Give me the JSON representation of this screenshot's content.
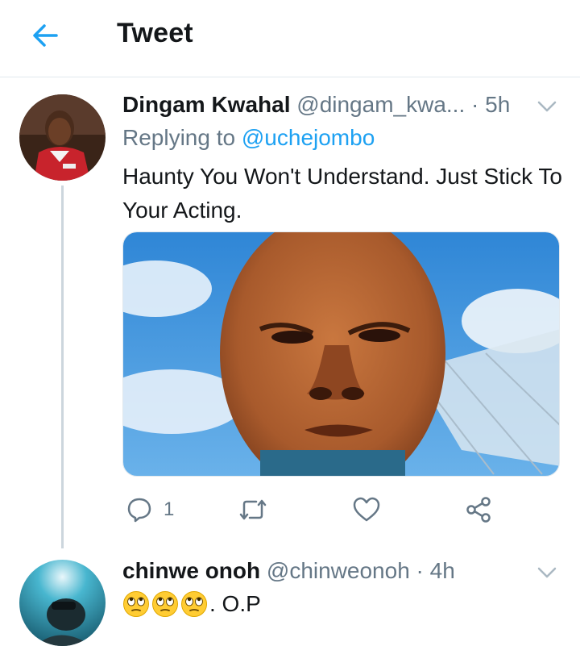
{
  "header": {
    "title": "Tweet"
  },
  "tweet1": {
    "name": "Dingam Kwahal",
    "handle": "@dingam_kwa...",
    "separator": " · ",
    "time": "5h",
    "replying_prefix": "Replying to ",
    "replying_to": "@uchejombo",
    "text": "Haunty You Won't Understand. Just Stick To Your Acting.",
    "actions": {
      "reply_count": "1"
    }
  },
  "tweet2": {
    "name": "chinwe onoh",
    "handle": "@chinweonoh",
    "separator": " · ",
    "time": "4h",
    "emojis": [
      "face-with-rolling-eyes",
      "face-with-rolling-eyes",
      "face-with-rolling-eyes"
    ],
    "text": ". O.P"
  },
  "colors": {
    "accent": "#1da1f2",
    "muted": "#657786",
    "text": "#14171a",
    "divider": "#e1e8ed"
  }
}
